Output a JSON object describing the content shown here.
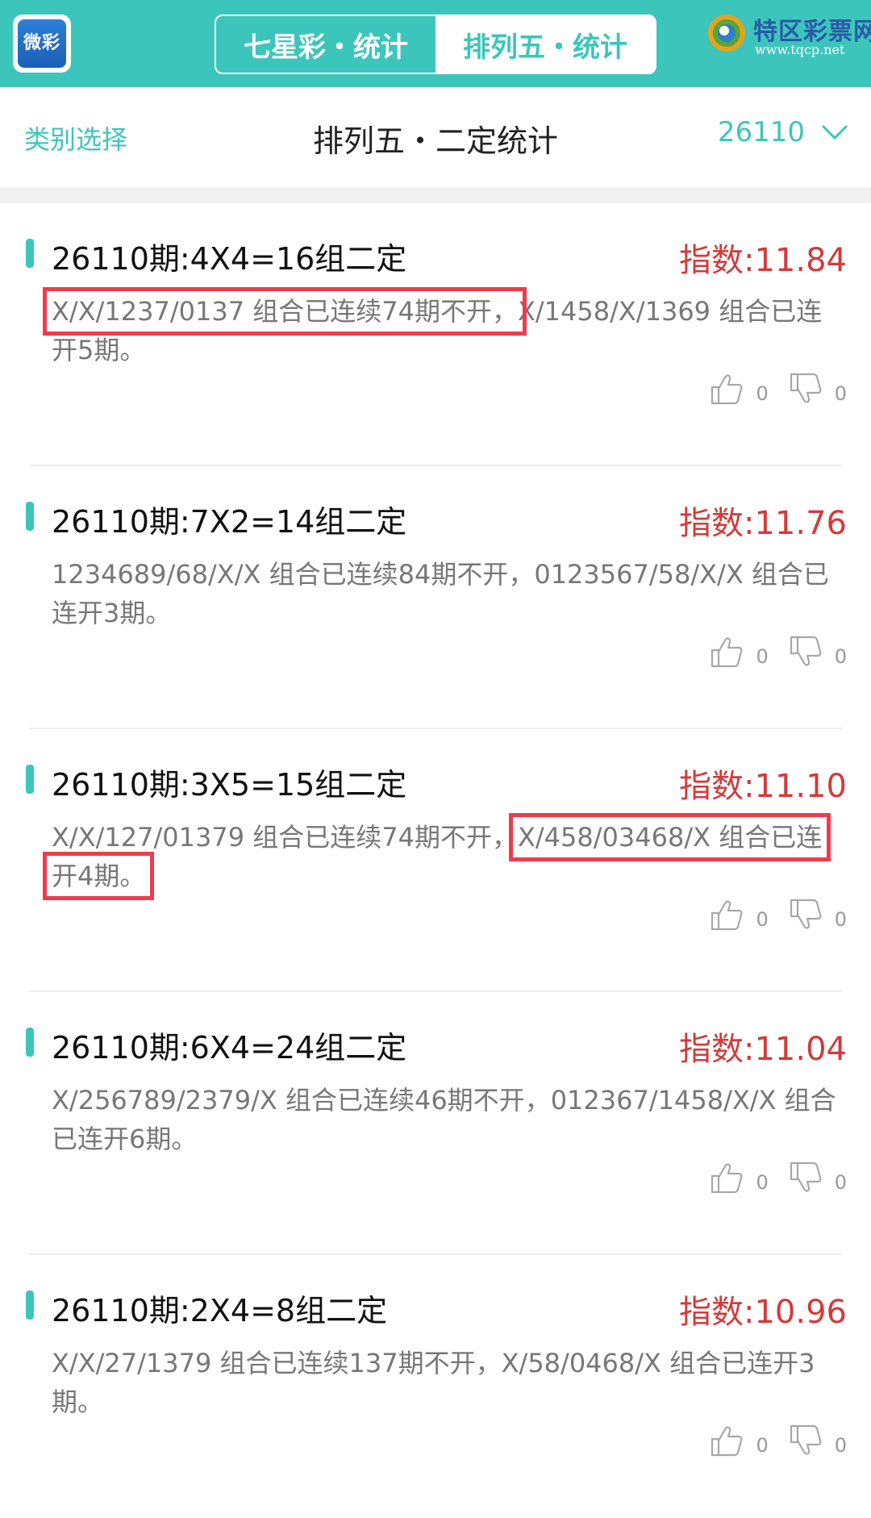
{
  "header": {
    "app_logo_text": "微彩",
    "tabs": [
      {
        "label": "七星彩・统计"
      },
      {
        "label": "排列五・统计"
      }
    ],
    "brand": {
      "name": "特区彩票网",
      "url": "www.tqcp.net"
    }
  },
  "subheader": {
    "category_label": "类别选择",
    "title": "排列五・二定统计",
    "issue": "26110"
  },
  "cards": [
    {
      "title": "26110期:4X4=16组二定",
      "index": "指数:11.84",
      "desc_parts": [
        "X/X/1237/0137 组合已连续74期不开，",
        "X/1458/X/1369 组合已连开5期。"
      ],
      "likes": "0",
      "dislikes": "0"
    },
    {
      "title": "26110期:7X2=14组二定",
      "index": "指数:11.76",
      "desc_parts": [
        "1234689/68/X/X 组合已连续84期不开，",
        "0123567/58/X/X 组合已连开3期。"
      ],
      "likes": "0",
      "dislikes": "0"
    },
    {
      "title": "26110期:3X5=15组二定",
      "index": "指数:11.10",
      "desc_parts": [
        "X/X/127/01379 组合已连续74期不开，",
        "X/458/03468/X 组合已连开4期。"
      ],
      "likes": "0",
      "dislikes": "0"
    },
    {
      "title": "26110期:6X4=24组二定",
      "index": "指数:11.04",
      "desc_parts": [
        "X/256789/2379/X 组合已连续46期不开，",
        "012367/1458/X/X 组合已连开6期。"
      ],
      "likes": "0",
      "dislikes": "0"
    },
    {
      "title": "26110期:2X4=8组二定",
      "index": "指数:10.96",
      "desc_parts": [
        "X/X/27/1379 组合已连续137期不开，",
        "X/58/0468/X 组合已连开3期。"
      ],
      "likes": "0",
      "dislikes": "0"
    }
  ],
  "colors": {
    "accent": "#3cc6bb",
    "index_red": "#d33a3a",
    "highlight_box": "#ef3b4c"
  },
  "icons": {
    "like": "thumbs-up-icon",
    "dislike": "thumbs-down-icon",
    "dropdown": "chevron-down-icon"
  }
}
